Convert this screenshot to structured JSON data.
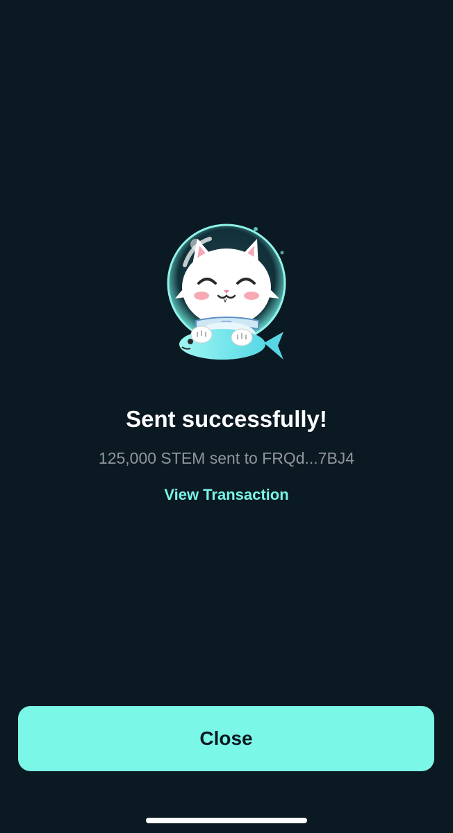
{
  "success": {
    "mascot_icon": "astronaut-cat-icon",
    "title": "Sent successfully!",
    "message": "125,000 STEM sent to FRQd...7BJ4",
    "view_transaction_label": "View Transaction"
  },
  "footer": {
    "close_label": "Close"
  },
  "colors": {
    "background": "#0b1922",
    "accent": "#7af7e6",
    "title_text": "#ffffff",
    "secondary_text": "#8f969c",
    "button_text": "#0b1922"
  }
}
